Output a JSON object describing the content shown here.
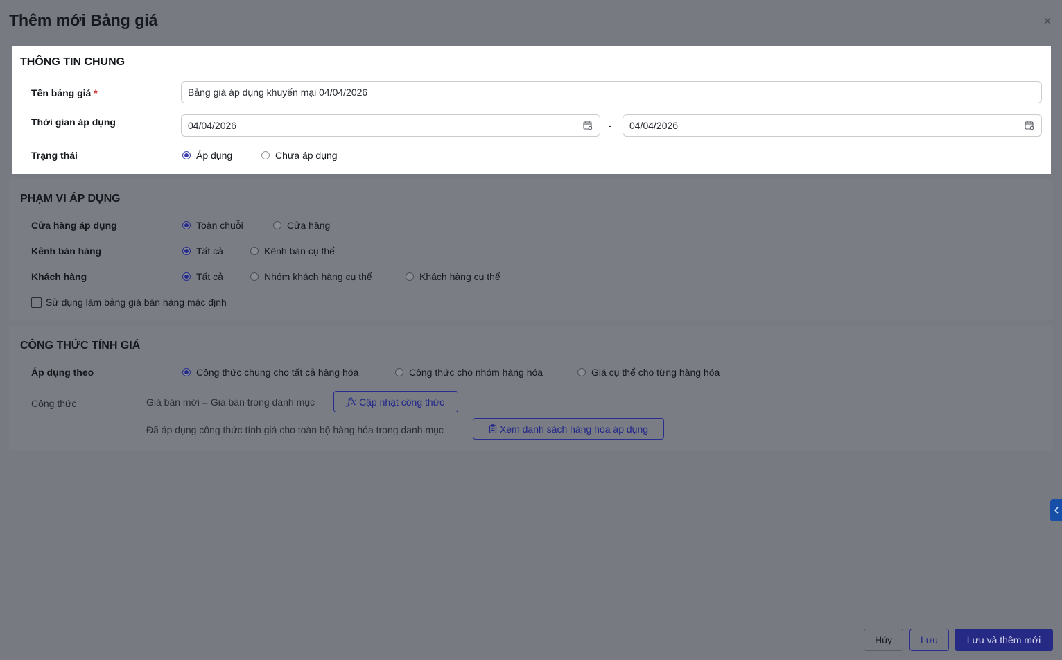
{
  "modal": {
    "title": "Thêm mới Bảng giá",
    "close_label": "×"
  },
  "general": {
    "title": "THÔNG TIN CHUNG",
    "name_label": "Tên bảng giá",
    "required_mark": "*",
    "name_value": "Bảng giá áp dụng khuyến mại 04/04/2026",
    "period_label": "Thời gian áp dụng",
    "date_from": "04/04/2026",
    "date_separator": "-",
    "date_to": "04/04/2026",
    "status_label": "Trạng thái",
    "status_options": [
      "Áp dụng",
      "Chưa áp dụng"
    ],
    "status_selected": "Áp dụng"
  },
  "scope": {
    "title": "PHẠM VI ÁP DỤNG",
    "store_label": "Cửa hàng áp dụng",
    "store_options": [
      "Toàn chuỗi",
      "Cửa hàng"
    ],
    "channel_label": "Kênh bán hàng",
    "channel_options": [
      "Tất cả",
      "Kênh bán cụ thể"
    ],
    "customer_label": "Khách hàng",
    "customer_options": [
      "Tất cả",
      "Nhóm khách hàng cụ thể",
      "Khách hàng cụ thể"
    ],
    "default_checkbox_label": "Sử dụng làm bảng giá bán hàng mặc định",
    "default_checked": false
  },
  "formula": {
    "title": "CÔNG THỨC TÍNH GIÁ",
    "apply_label": "Áp dụng theo",
    "apply_options": [
      "Công thức chung cho tất cả hàng hóa",
      "Công thức cho nhóm hàng hóa",
      "Giá cụ thể cho từng hàng hóa"
    ],
    "apply_selected": "Công thức chung cho tất cả hàng hóa",
    "formula_label": "Công thức",
    "formula_text": "Giá bán mới = Giá bán trong danh mục",
    "update_button": "Cập nhật công thức",
    "applied_text": "Đã áp dụng công thức tính giá cho toàn bộ hàng hóa trong danh mục",
    "view_list_button": "Xem danh sách hàng hóa áp dụng"
  },
  "footer": {
    "cancel": "Hủy",
    "save": "Lưu",
    "save_and_new": "Lưu và thêm mới"
  }
}
